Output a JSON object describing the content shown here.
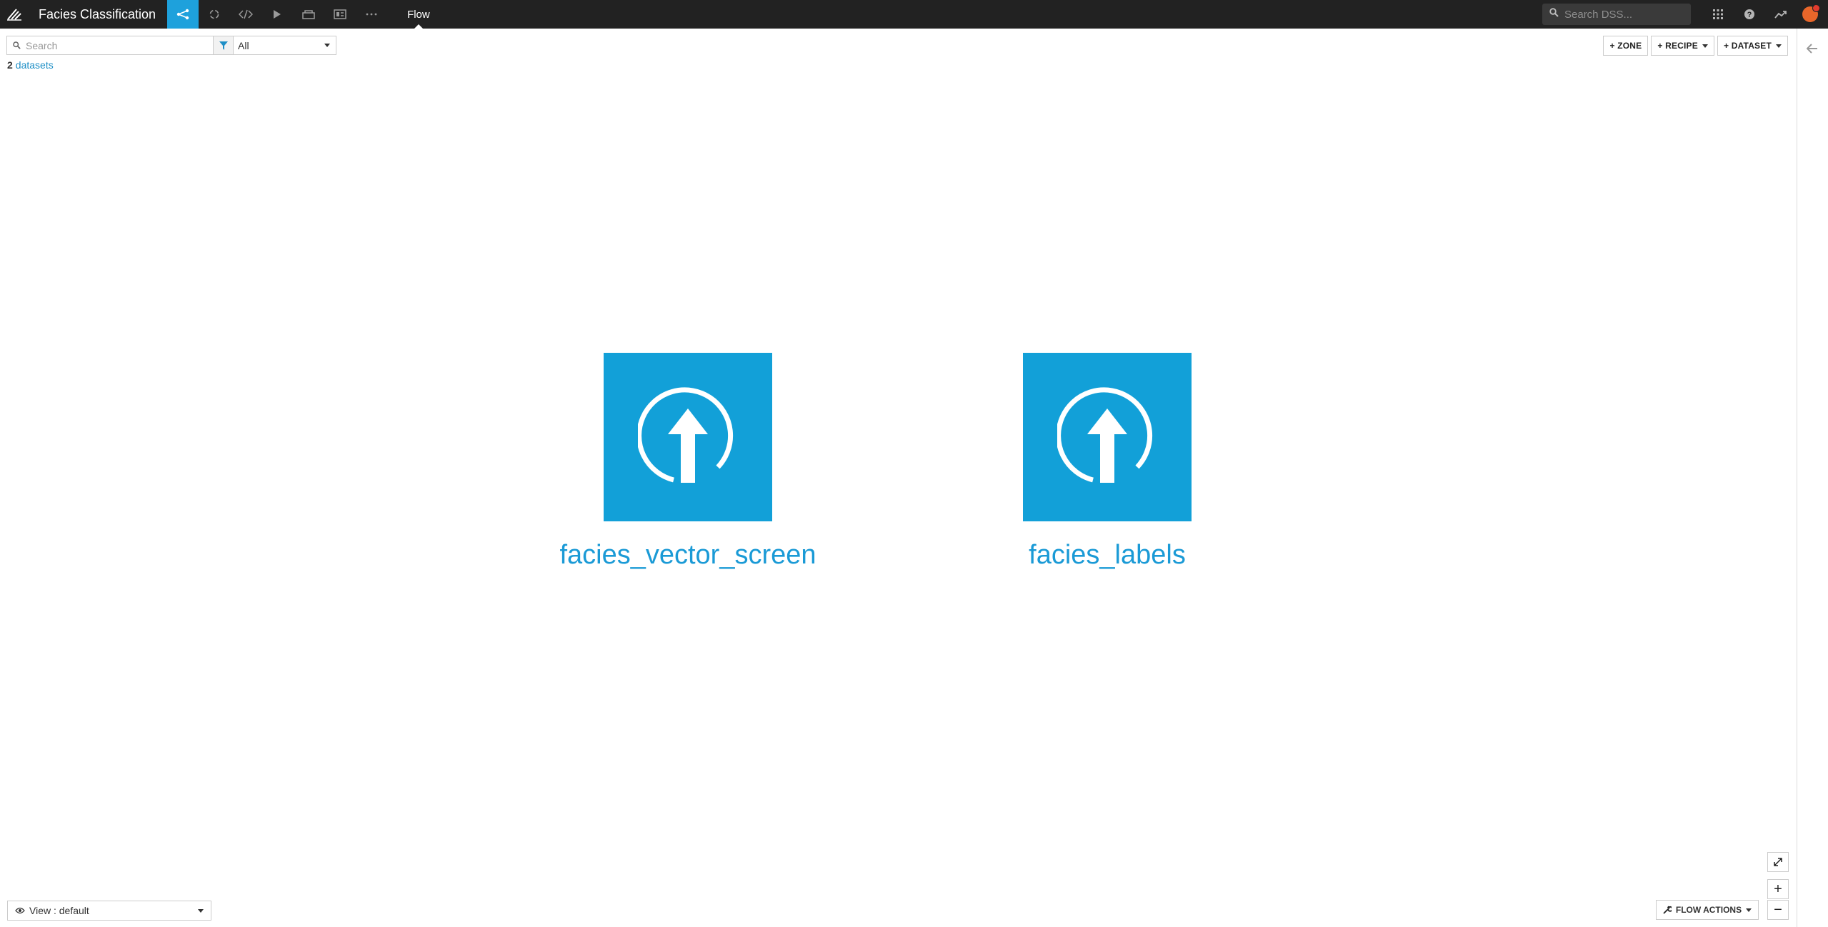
{
  "header": {
    "project_title": "Facies Classification",
    "breadcrumb": "Flow",
    "global_search_placeholder": "Search DSS...",
    "nav_icons": [
      "flow-icon",
      "refresh-icon",
      "code-icon",
      "run-icon",
      "notebook-icon",
      "dashboard-icon",
      "more-icon"
    ]
  },
  "filter": {
    "search_placeholder": "Search",
    "type_select": "All"
  },
  "summary": {
    "count": "2",
    "label": "datasets"
  },
  "toolbar": {
    "zone": "+ ZONE",
    "recipe": "+ RECIPE",
    "dataset": "+ DATASET"
  },
  "datasets": [
    {
      "name": "facies_vector_screen",
      "icon": "upload-icon"
    },
    {
      "name": "facies_labels",
      "icon": "upload-icon"
    }
  ],
  "bottom": {
    "view_select": "View : default",
    "flow_actions": "FLOW ACTIONS",
    "zoom_in": "+",
    "zoom_out": "−"
  },
  "colors": {
    "accent": "#1ea1dc",
    "dataset_tile": "#12a0d8",
    "topbar": "#222222"
  }
}
